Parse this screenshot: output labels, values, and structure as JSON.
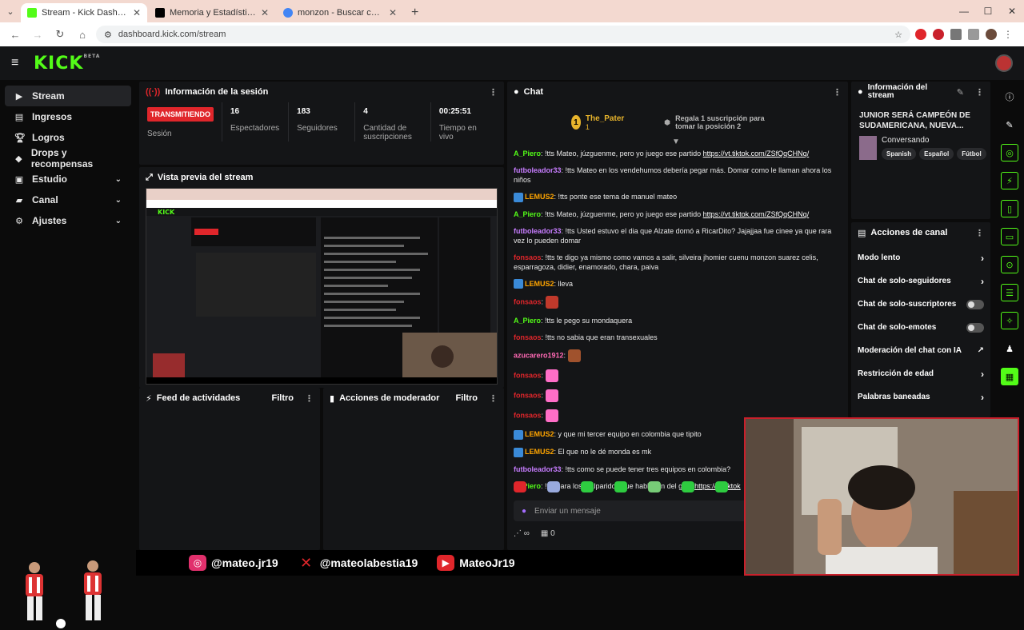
{
  "browser": {
    "tabs": [
      {
        "title": "Stream - Kick Dashboard",
        "color": "#53fc18"
      },
      {
        "title": "Memoria y Estadísticas del FPC",
        "color": "#000000"
      },
      {
        "title": "monzon - Buscar con Google",
        "color": "#4285f4"
      }
    ],
    "url": "dashboard.kick.com/stream"
  },
  "brand": {
    "logo": "KICK",
    "beta": "BETA",
    "accent": "#53fc18"
  },
  "sidebar": {
    "items": [
      {
        "label": "Stream",
        "icon": "play-icon"
      },
      {
        "label": "Ingresos",
        "icon": "money-icon"
      },
      {
        "label": "Logros",
        "icon": "trophy-icon"
      },
      {
        "label": "Drops y recompensas",
        "icon": "gift-icon"
      },
      {
        "label": "Estudio",
        "icon": "studio-icon"
      },
      {
        "label": "Canal",
        "icon": "channel-icon"
      },
      {
        "label": "Ajustes",
        "icon": "gear-icon"
      }
    ]
  },
  "session": {
    "title": "Información de la sesión",
    "status": "TRANSMITIENDO",
    "status_label": "Sesión",
    "stats": [
      {
        "value": "16",
        "label": "Espectadores"
      },
      {
        "value": "183",
        "label": "Seguidores"
      },
      {
        "value": "4",
        "label": "Cantidad de suscripciones"
      },
      {
        "value": "00:25:51",
        "label": "Tiempo en vivo"
      }
    ]
  },
  "preview": {
    "title": "Vista previa del stream"
  },
  "feed": {
    "title": "Feed de actividades",
    "filter": "Filtro"
  },
  "modactions": {
    "title": "Acciones de moderador",
    "filter": "Filtro"
  },
  "chat": {
    "title": "Chat",
    "pinned": {
      "rank": "1",
      "user": "The_Pater",
      "count": "1",
      "text": "Regala 1 suscripción para tomar la posición 2"
    },
    "messages": [
      {
        "user": "A_Piero",
        "color": "#53fc18",
        "text": "!tts Mateo, júzguenme, pero yo juego ese partido ",
        "link": "https://vt.tiktok.com/ZSfQqCHNq/"
      },
      {
        "user": "futboleador33",
        "color": "#c77dff",
        "text": "!tts Mateo en los vendehumos debería pegar más. Domar como le llaman ahora los niños"
      },
      {
        "user": "LEMUS2",
        "color": "#ffa500",
        "text": "!tts ponte ese tema de manuel mateo",
        "badge": true
      },
      {
        "user": "A_Piero",
        "color": "#53fc18",
        "text": "!tts Mateo, júzguenme, pero yo juego ese partido ",
        "link": "https://vt.tiktok.com/ZSfQqCHNq/"
      },
      {
        "user": "futboleador33",
        "color": "#c77dff",
        "text": "!tts Usted estuvo el dia que Alzate domó a RicarDito? Jajajjaa fue cinee ya que rara vez lo pueden domar"
      },
      {
        "user": "fonsaos",
        "color": "#e0262b",
        "text": "!tts te digo ya mismo como vamos a salir, silveira jhomier cuenu monzon suarez celis, esparragoza, didier, enamorado, chara, paiva"
      },
      {
        "user": "LEMUS2",
        "color": "#ffa500",
        "text": "lleva",
        "badge": true
      },
      {
        "user": "fonsaos",
        "color": "#e0262b",
        "text": "",
        "emote": "#c0392b"
      },
      {
        "user": "A_Piero",
        "color": "#53fc18",
        "text": "!tts le pego su mondaquera"
      },
      {
        "user": "fonsaos",
        "color": "#e0262b",
        "text": "!tts no sabia que eran transexuales"
      },
      {
        "user": "azucarero1912",
        "color": "#ff69b4",
        "text": "",
        "emote": "#a0522d"
      },
      {
        "user": "fonsaos",
        "color": "#e0262b",
        "text": "",
        "emote": "#ff6ec7"
      },
      {
        "user": "fonsaos",
        "color": "#e0262b",
        "text": "",
        "emote": "#ff6ec7"
      },
      {
        "user": "fonsaos",
        "color": "#e0262b",
        "text": "",
        "emote": "#ff6ec7"
      },
      {
        "user": "LEMUS2",
        "color": "#ffa500",
        "text": "y que mi tercer equipo en colombia que tipito",
        "badge": true
      },
      {
        "user": "LEMUS2",
        "color": "#ffa500",
        "text": "El que no le dé monda es mk",
        "badge": true
      },
      {
        "user": "futboleador33",
        "color": "#c77dff",
        "text": "!tts como se puede tener tres equipos en colombia?"
      },
      {
        "user": "A_Piero",
        "color": "#53fc18",
        "text": "!tts para los malparidos que hablaban del goat ",
        "link": "https://vt.tiktok"
      }
    ],
    "input_placeholder": "Enviar un mensaje",
    "bottom": {
      "infinity": "∞",
      "count": "0"
    }
  },
  "streaminfo": {
    "title": "Información del stream",
    "stream_title": "JUNIOR SERÁ CAMPEÓN DE SUDAMERICANA, NUEVA...",
    "category": "Conversando",
    "tags": [
      "Spanish",
      "Español",
      "Fútbol"
    ]
  },
  "channel_actions": {
    "title": "Acciones de canal",
    "rows": [
      {
        "label": "Modo lento",
        "kind": "chevron"
      },
      {
        "label": "Chat de solo-seguidores",
        "kind": "chevron"
      },
      {
        "label": "Chat de solo-suscriptores",
        "kind": "toggle"
      },
      {
        "label": "Chat de solo-emotes",
        "kind": "toggle"
      },
      {
        "label": "Moderación del chat con IA",
        "kind": "chart"
      },
      {
        "label": "Restricción de edad",
        "kind": "chevron"
      },
      {
        "label": "Palabras baneadas",
        "kind": "chevron"
      }
    ]
  },
  "socials": [
    {
      "handle": "@mateo.jr19",
      "icon": "instagram-icon",
      "color": "#e1306c"
    },
    {
      "handle": "@mateolabestia19",
      "icon": "x-icon",
      "color": "#e0262b"
    },
    {
      "handle": "MateoJr19",
      "icon": "youtube-icon",
      "color": "#e0262b"
    }
  ]
}
